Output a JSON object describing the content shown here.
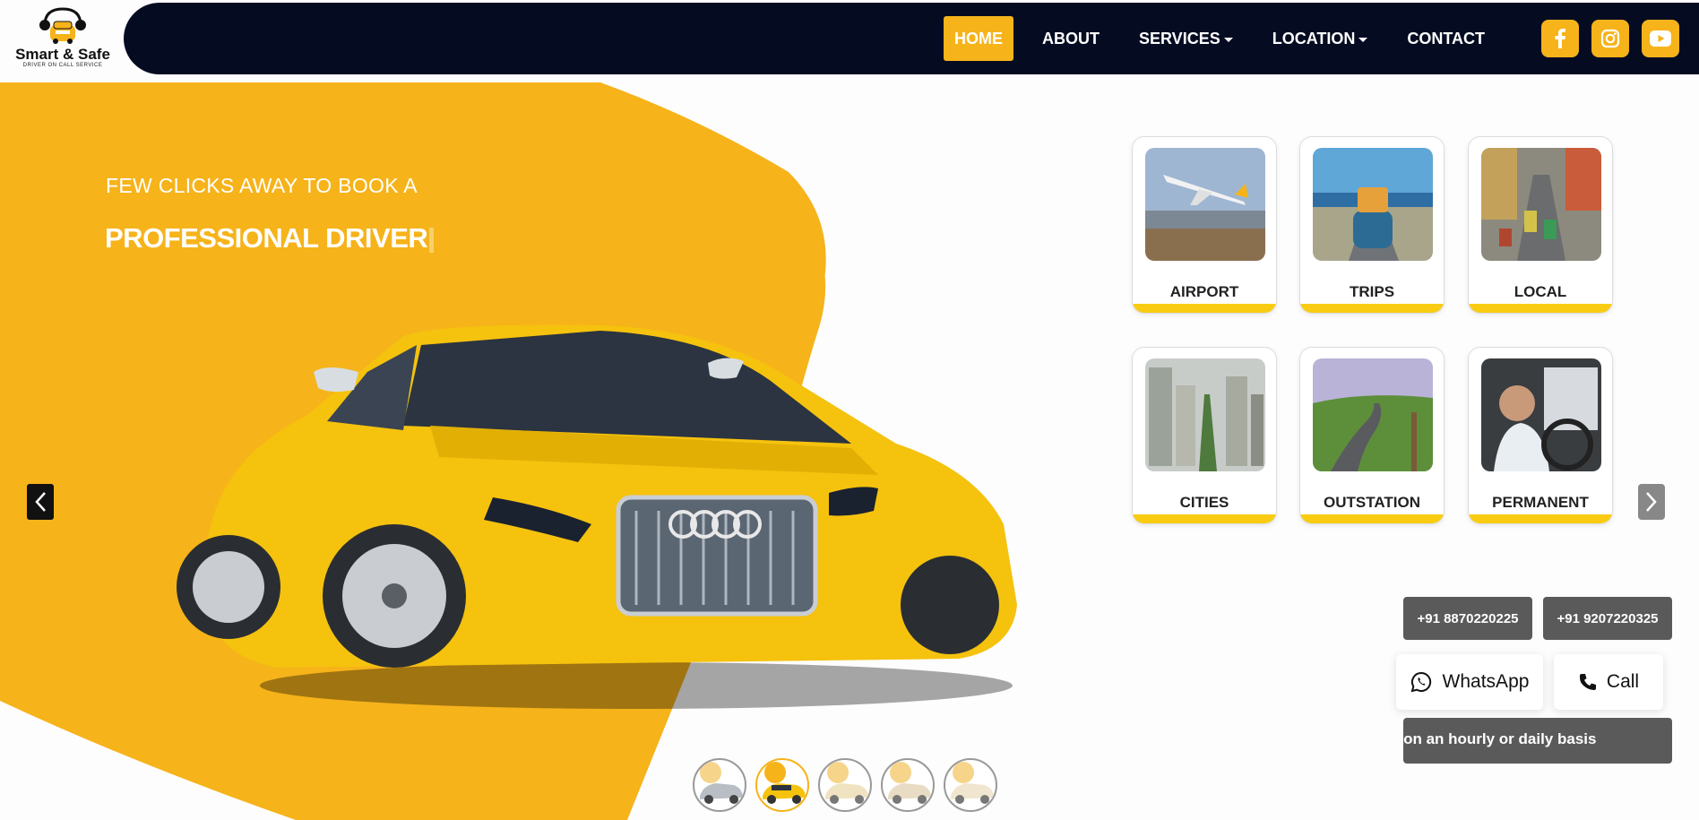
{
  "brand": {
    "name": "Smart & Safe",
    "tagline": "DRIVER ON CALL SERVICE"
  },
  "nav": {
    "items": [
      {
        "label": "HOME",
        "active": true,
        "dropdown": false
      },
      {
        "label": "ABOUT",
        "active": false,
        "dropdown": false
      },
      {
        "label": "SERVICES",
        "active": false,
        "dropdown": true
      },
      {
        "label": "LOCATION",
        "active": false,
        "dropdown": true
      },
      {
        "label": "CONTACT",
        "active": false,
        "dropdown": false
      }
    ],
    "social": [
      {
        "icon": "facebook-icon"
      },
      {
        "icon": "instagram-icon"
      },
      {
        "icon": "youtube-icon"
      }
    ]
  },
  "hero": {
    "line1": "FEW CLICKS AWAY TO BOOK A",
    "line2": "PROFESSIONAL DRIVER"
  },
  "services": [
    {
      "label": "AIRPORT",
      "icon": "airplane-image"
    },
    {
      "label": "TRIPS",
      "icon": "road-trip-image"
    },
    {
      "label": "LOCAL",
      "icon": "city-street-image"
    },
    {
      "label": "CITIES",
      "icon": "cityscape-image"
    },
    {
      "label": "OUTSTATION",
      "icon": "highway-image"
    },
    {
      "label": "PERMANENT",
      "icon": "driver-image"
    }
  ],
  "contact": {
    "phone1": "+91 8870220225",
    "phone2": "+91 9207220325",
    "whatsapp_label": "WhatsApp",
    "call_label": "Call",
    "ticker": "Professional Drivers on an hourly or daily basis"
  },
  "carousel": {
    "slides": 5,
    "active_index": 2
  },
  "colors": {
    "accent": "#f6b31a",
    "navbar": "#050c22",
    "card_bar": "#f9cc13",
    "grey_button": "#5a5a5a"
  }
}
